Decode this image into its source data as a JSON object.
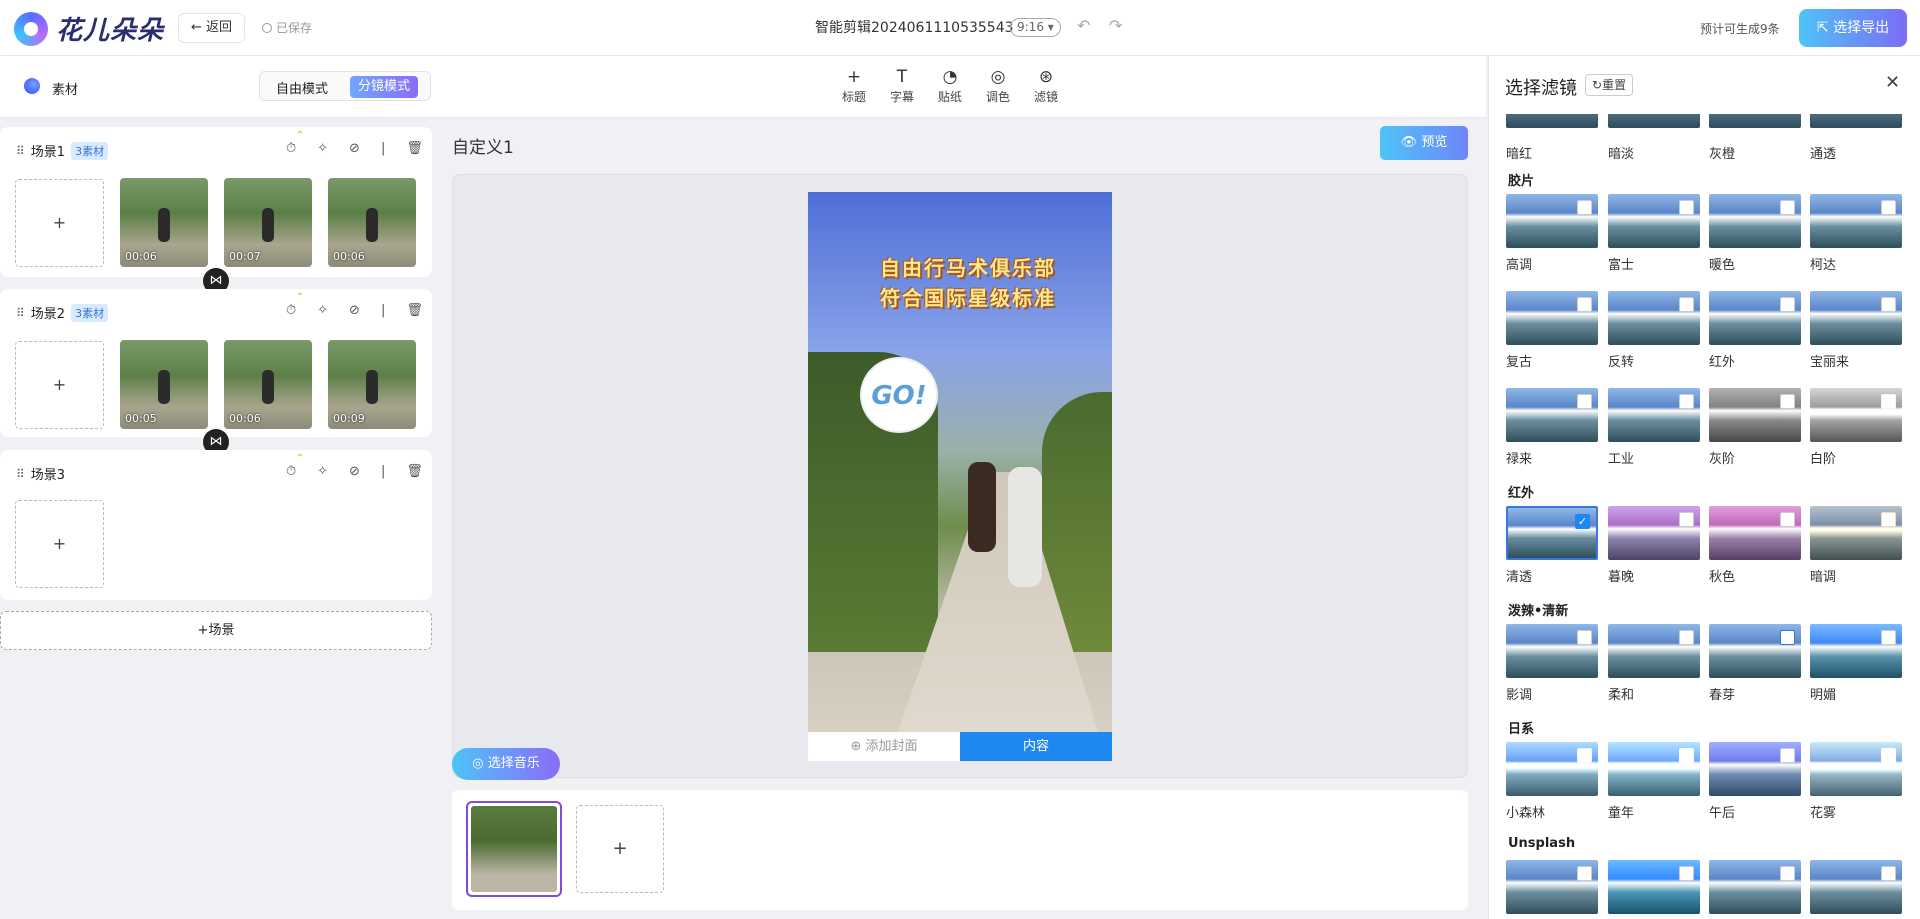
{
  "header": {
    "logo_text": "花儿朵朵",
    "back_label": "← 返回",
    "saved_label": "已保存",
    "doc_title": "智能剪辑2024061110535543",
    "ratio": "9:16 ▾",
    "estimate": "预计可生成9条",
    "export_label": "选择导出"
  },
  "toolbar": {
    "material_label": "素材",
    "mode_free": "自由模式",
    "mode_split": "分镜模式",
    "tools": [
      {
        "icon": "+",
        "label": "标题"
      },
      {
        "icon": "T",
        "label": "字幕"
      },
      {
        "icon": "◔",
        "label": "贴纸"
      },
      {
        "icon": "◎",
        "label": "调色"
      },
      {
        "icon": "⊛",
        "label": "滤镜"
      }
    ]
  },
  "scenes": [
    {
      "name": "场景1",
      "badge": "3素材",
      "clips": [
        "00:06",
        "00:07",
        "00:06"
      ]
    },
    {
      "name": "场景2",
      "badge": "3素材",
      "clips": [
        "00:05",
        "00:06",
        "00:09"
      ]
    },
    {
      "name": "场景3",
      "badge": "",
      "clips": []
    }
  ],
  "add_scene_label": "+场景",
  "editor": {
    "title": "自定义1",
    "preview_label": "预览",
    "caption_line1": "自由行马术俱乐部",
    "caption_line2": "符合国际星级标准",
    "sticker_text": "GO!",
    "cover_tab": "添加封面",
    "content_tab": "内容",
    "music_label": "选择音乐"
  },
  "filters": {
    "title": "选择滤镜",
    "reset_label": "重置",
    "top_row": [
      "暗红",
      "暗淡",
      "灰橙",
      "通透"
    ],
    "groups": [
      {
        "name": "胶片",
        "items": [
          "高调",
          "富士",
          "暖色",
          "柯达",
          "复古",
          "反转",
          "红外",
          "宝丽来",
          "禄来",
          "工业",
          "灰阶",
          "白阶"
        ]
      },
      {
        "name": "红外",
        "items": [
          "清透",
          "暮晚",
          "秋色",
          "暗调"
        ]
      },
      {
        "name": "泼辣•清新",
        "items": [
          "影调",
          "柔和",
          "春芽",
          "明媚"
        ]
      },
      {
        "name": "日系",
        "items": [
          "小森林",
          "童年",
          "午后",
          "花雾"
        ]
      },
      {
        "name": "Unsplash",
        "items": []
      }
    ],
    "selected": "清透"
  }
}
